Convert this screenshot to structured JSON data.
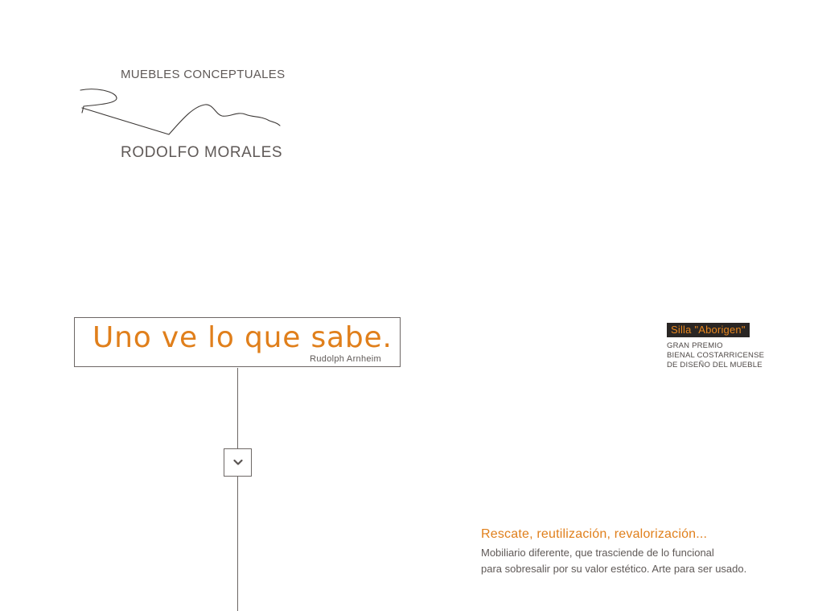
{
  "logo": {
    "top_text": "MUEBLES CONCEPTUALES",
    "bottom_text": "RODOLFO MORALES"
  },
  "quote": {
    "text": "Uno ve lo que sabe.",
    "author": "Rudolph Arnheim"
  },
  "scroll_button": {
    "icon": "chevron-down-icon"
  },
  "award": {
    "badge": "Silla \"Aborigen\"",
    "line1": "GRAN PREMIO",
    "line2": "BIENAL COSTARRICENSE",
    "line3": "DE DISEÑO DEL MUEBLE"
  },
  "tagline": {
    "title": "Rescate, reutilización, revalorización...",
    "body_line1": "Mobiliario diferente, que trasciende de lo funcional",
    "body_line2": "para sobresalir por su valor estético. Arte para ser usado."
  },
  "colors": {
    "accent": "#e07f1b",
    "text": "#5f5957",
    "badge_bg": "#2a2624"
  }
}
